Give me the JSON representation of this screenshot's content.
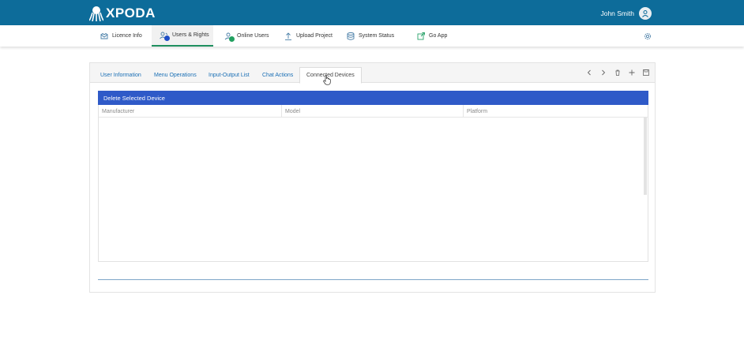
{
  "app": {
    "title": "XPODA",
    "user_name": "John Smith"
  },
  "nav": {
    "items": [
      {
        "label": "Licence Info",
        "icon": "license-icon"
      },
      {
        "label": "Users & Rights",
        "icon": "users-rights-icon",
        "active": true
      },
      {
        "label": "Online Users",
        "icon": "online-users-icon"
      },
      {
        "label": "Upload Project",
        "icon": "upload-icon"
      },
      {
        "label": "System Status",
        "icon": "database-icon"
      },
      {
        "label": "Go App",
        "icon": "external-link-icon"
      }
    ]
  },
  "tabs": [
    {
      "label": "User Information"
    },
    {
      "label": "Menu Operations"
    },
    {
      "label": "Input-Output List"
    },
    {
      "label": "Chat Actions"
    },
    {
      "label": "Connected Devices",
      "active": true
    }
  ],
  "devices": {
    "delete_label": "Delete Selected Device",
    "columns": [
      "Manufacturer",
      "Model",
      "Platform"
    ],
    "rows": []
  },
  "colors": {
    "topbar": "#0d6c9a",
    "delete_bar": "#2f5ac8",
    "active_tab_underline": "#1f8f5f"
  }
}
